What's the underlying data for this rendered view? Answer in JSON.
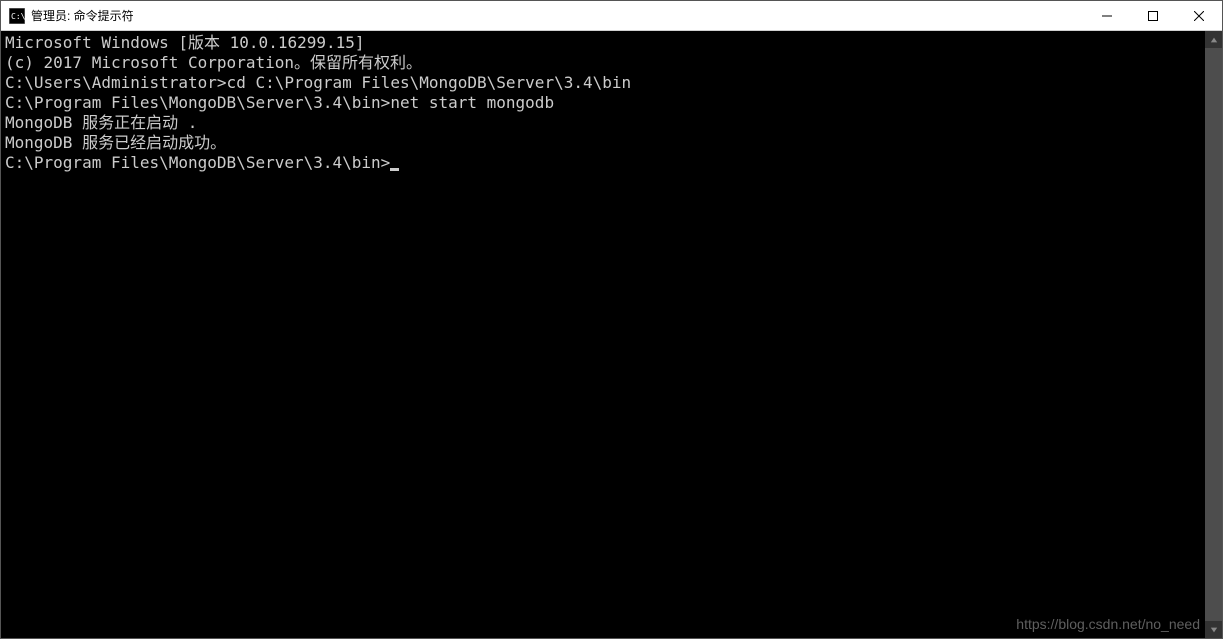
{
  "titlebar": {
    "title": "管理员: 命令提示符"
  },
  "terminal": {
    "lines": [
      "Microsoft Windows [版本 10.0.16299.15]",
      "(c) 2017 Microsoft Corporation。保留所有权利。",
      "",
      "C:\\Users\\Administrator>cd C:\\Program Files\\MongoDB\\Server\\3.4\\bin",
      "",
      "C:\\Program Files\\MongoDB\\Server\\3.4\\bin>net start mongodb",
      "MongoDB 服务正在启动 .",
      "MongoDB 服务已经启动成功。",
      "",
      "",
      "C:\\Program Files\\MongoDB\\Server\\3.4\\bin>"
    ]
  },
  "watermark": "https://blog.csdn.net/no_need"
}
